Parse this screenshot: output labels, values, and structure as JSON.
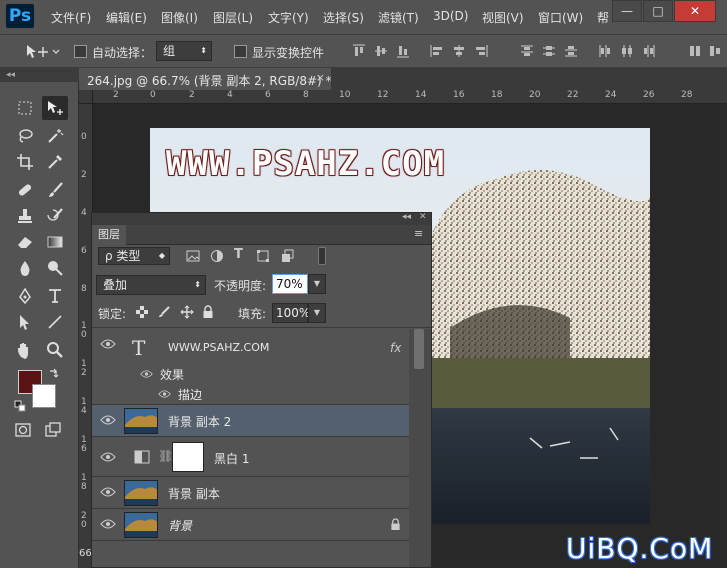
{
  "app": {
    "logo": "Ps"
  },
  "menu": [
    "文件(F)",
    "编辑(E)",
    "图像(I)",
    "图层(L)",
    "文字(Y)",
    "选择(S)",
    "滤镜(T)",
    "3D(D)",
    "视图(V)",
    "窗口(W)",
    "帮"
  ],
  "window_buttons": {
    "minimize": "—",
    "maximize": "□",
    "close": "✕"
  },
  "options": {
    "auto_select_label": "自动选择：",
    "auto_select_value": "组",
    "show_transform_label": "显示变换控件"
  },
  "document": {
    "tab_title": "264.jpg @ 66.7% (背景 副本 2, RGB/8#) *",
    "tab_close": "×",
    "watermark_text": "WWW.PSAHZ.COM",
    "zoom_readout": "66",
    "hruler_ticks": [
      "2",
      "0",
      "2",
      "4",
      "6",
      "8",
      "10",
      "12",
      "14",
      "16",
      "18",
      "20",
      "22",
      "24",
      "26",
      "28"
    ],
    "vruler_ticks": [
      "0",
      "2",
      "4",
      "6",
      "8",
      "1\n0",
      "1\n2",
      "1\n4",
      "1\n6",
      "1\n8",
      "2\n0"
    ]
  },
  "tools_header": "◂◂",
  "colors": {
    "foreground": "#5a1212",
    "background": "#ffffff",
    "accent_selected": "#55606f"
  },
  "layers_panel": {
    "tab_label": "图层",
    "collapse_label": "◂◂",
    "close_label": "✕",
    "menu_label": "≡",
    "filter_kind": "ρ 类型",
    "filter_kind_arrow": "◆",
    "blend_mode": "叠加",
    "opacity_label": "不透明度:",
    "opacity_value": "70%",
    "lock_label": "锁定:",
    "fill_label": "填充:",
    "fill_value": "100%",
    "layers": [
      {
        "name": "WWW.PSAHZ.COM",
        "type": "text",
        "fx": "fx",
        "effects_label": "效果",
        "effect_items": [
          "描边"
        ]
      },
      {
        "name": "背景 副本 2",
        "type": "image",
        "selected": true
      },
      {
        "name": "黑白 1",
        "type": "adjustment"
      },
      {
        "name": "背景 副本",
        "type": "image"
      },
      {
        "name": "背景",
        "type": "image",
        "locked": true
      }
    ]
  },
  "site_watermark": "UiBQ.CoM"
}
